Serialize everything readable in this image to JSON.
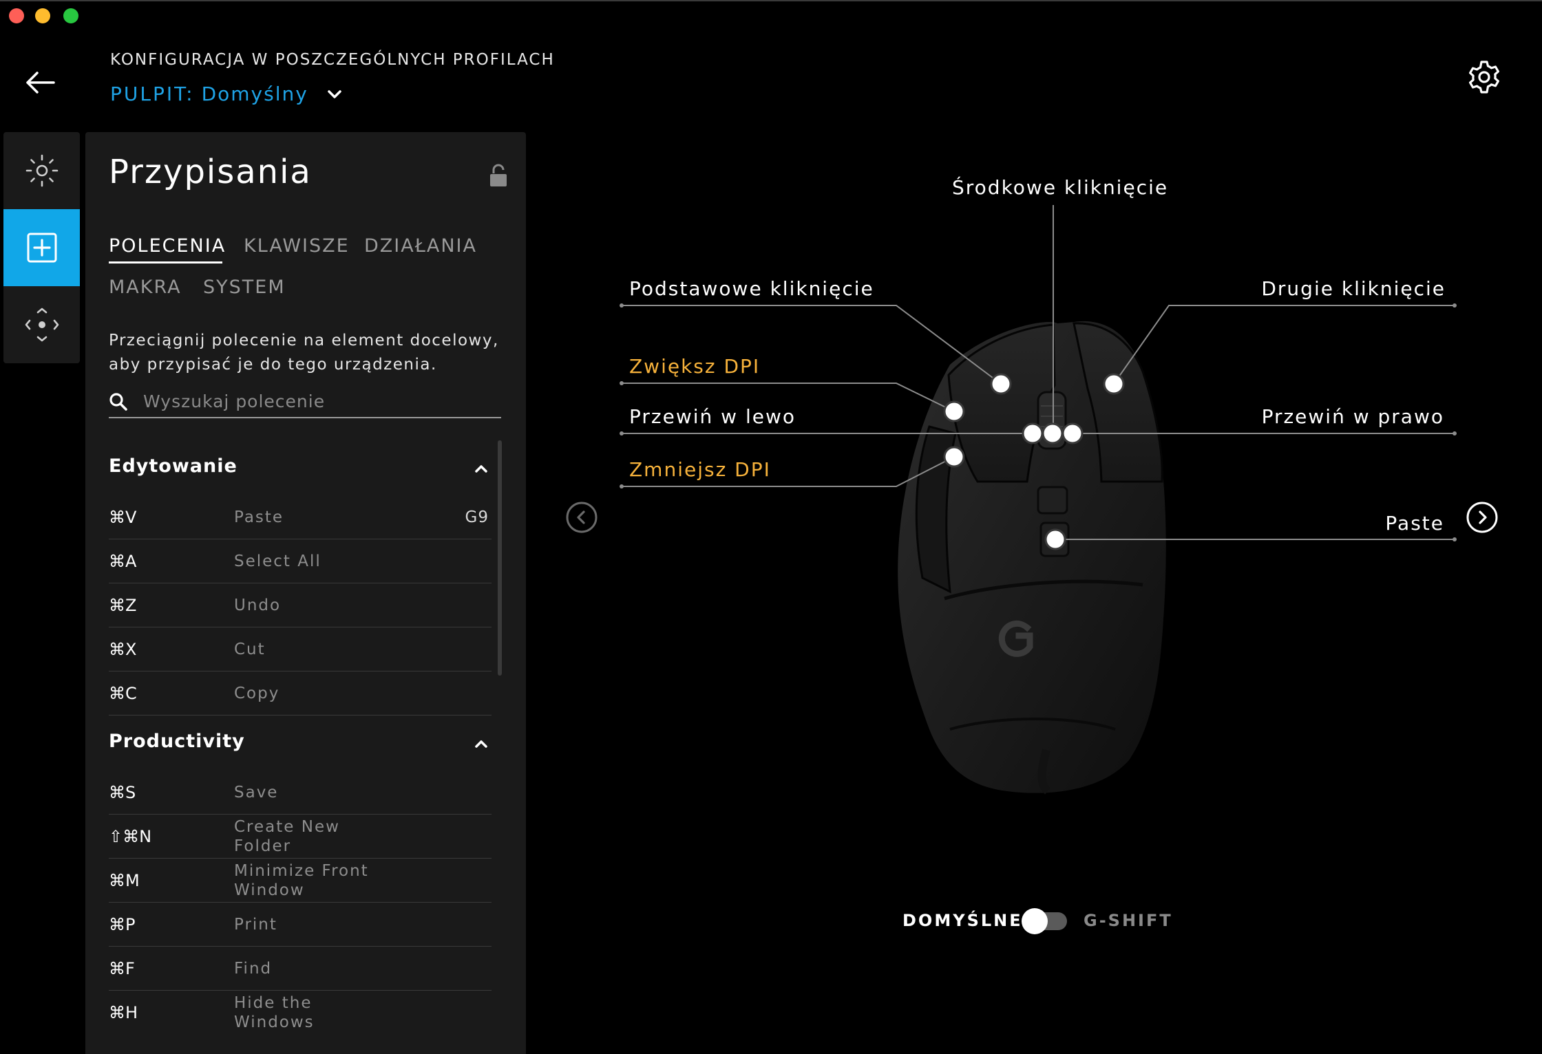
{
  "header": {
    "title": "KONFIGURACJA W POSZCZEGÓLNYCH PROFILACH",
    "profile_label": "PULPIT:",
    "profile_value": "Domyślny"
  },
  "rail": {
    "items": [
      "lighting",
      "assignments",
      "dpi"
    ]
  },
  "panel": {
    "title": "Przypisania",
    "tabs": [
      {
        "label": "POLECENIA",
        "active": true
      },
      {
        "label": "KLAWISZE",
        "active": false
      },
      {
        "label": "DZIAŁANIA",
        "active": false
      },
      {
        "label": "MAKRA",
        "active": false
      },
      {
        "label": "SYSTEM",
        "active": false
      }
    ],
    "description_line1": "Przeciągnij polecenie na element docelowy,",
    "description_line2": "aby przypisać je do tego urządzenia.",
    "search_placeholder": "Wyszukaj polecenie",
    "groups": [
      {
        "title": "Edytowanie",
        "rows": [
          {
            "key": "⌘V",
            "name": "Paste",
            "assigned": "G9"
          },
          {
            "key": "⌘A",
            "name": "Select All",
            "assigned": ""
          },
          {
            "key": "⌘Z",
            "name": "Undo",
            "assigned": ""
          },
          {
            "key": "⌘X",
            "name": "Cut",
            "assigned": ""
          },
          {
            "key": "⌘C",
            "name": "Copy",
            "assigned": ""
          }
        ]
      },
      {
        "title": "Productivity",
        "rows": [
          {
            "key": "⌘S",
            "name": "Save",
            "assigned": ""
          },
          {
            "key": "⇧⌘N",
            "name": "Create New Folder",
            "assigned": ""
          },
          {
            "key": "⌘M",
            "name": "Minimize Front Window",
            "assigned": ""
          },
          {
            "key": "⌘P",
            "name": "Print",
            "assigned": ""
          },
          {
            "key": "⌘F",
            "name": "Find",
            "assigned": ""
          },
          {
            "key": "⌘H",
            "name": "Hide the Windows",
            "assigned": ""
          }
        ]
      }
    ]
  },
  "mouse": {
    "callouts": {
      "middle": "Środkowe kliknięcie",
      "primary": "Podstawowe kliknięcie",
      "secondary": "Drugie kliknięcie",
      "dpi_up": "Zwiększ DPI",
      "scroll_left": "Przewiń w lewo",
      "scroll_right": "Przewiń w prawo",
      "dpi_down": "Zmniejsz DPI",
      "g9": "Paste"
    },
    "orange": "#f7b23b",
    "accent": "#11a7e8"
  },
  "mode_toggle": {
    "left_label": "DOMYŚLNE",
    "right_label": "G-SHIFT",
    "state": "DOMYŚLNE"
  }
}
